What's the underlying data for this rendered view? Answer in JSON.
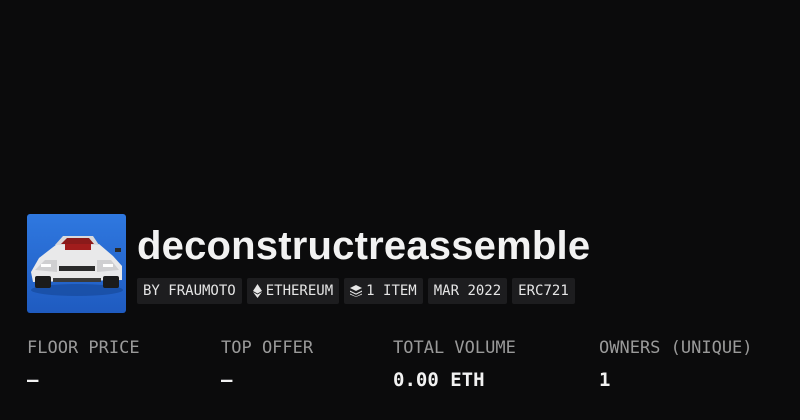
{
  "collection": {
    "title": "deconstructreassemble",
    "avatar_icon": "sports-car-image",
    "tags": {
      "creator": "BY FRAUMOTO",
      "chain": "ETHEREUM",
      "chain_icon": "ethereum-icon",
      "items": "1 ITEM",
      "items_icon": "layers-icon",
      "date": "MAR 2022",
      "standard": "ERC721"
    }
  },
  "stats": {
    "floor_price": {
      "label": "FLOOR PRICE",
      "value": "—"
    },
    "top_offer": {
      "label": "TOP OFFER",
      "value": "—"
    },
    "total_volume": {
      "label": "TOTAL VOLUME",
      "value": "0.00 ETH"
    },
    "owners": {
      "label": "OWNERS (UNIQUE)",
      "value": "1"
    }
  },
  "colors": {
    "background": "#0b0b0c",
    "tag_background": "#1d1d1f",
    "label": "#9a9a9a",
    "text": "#f2f2f2",
    "avatar_sky": "#2d6fd6"
  }
}
